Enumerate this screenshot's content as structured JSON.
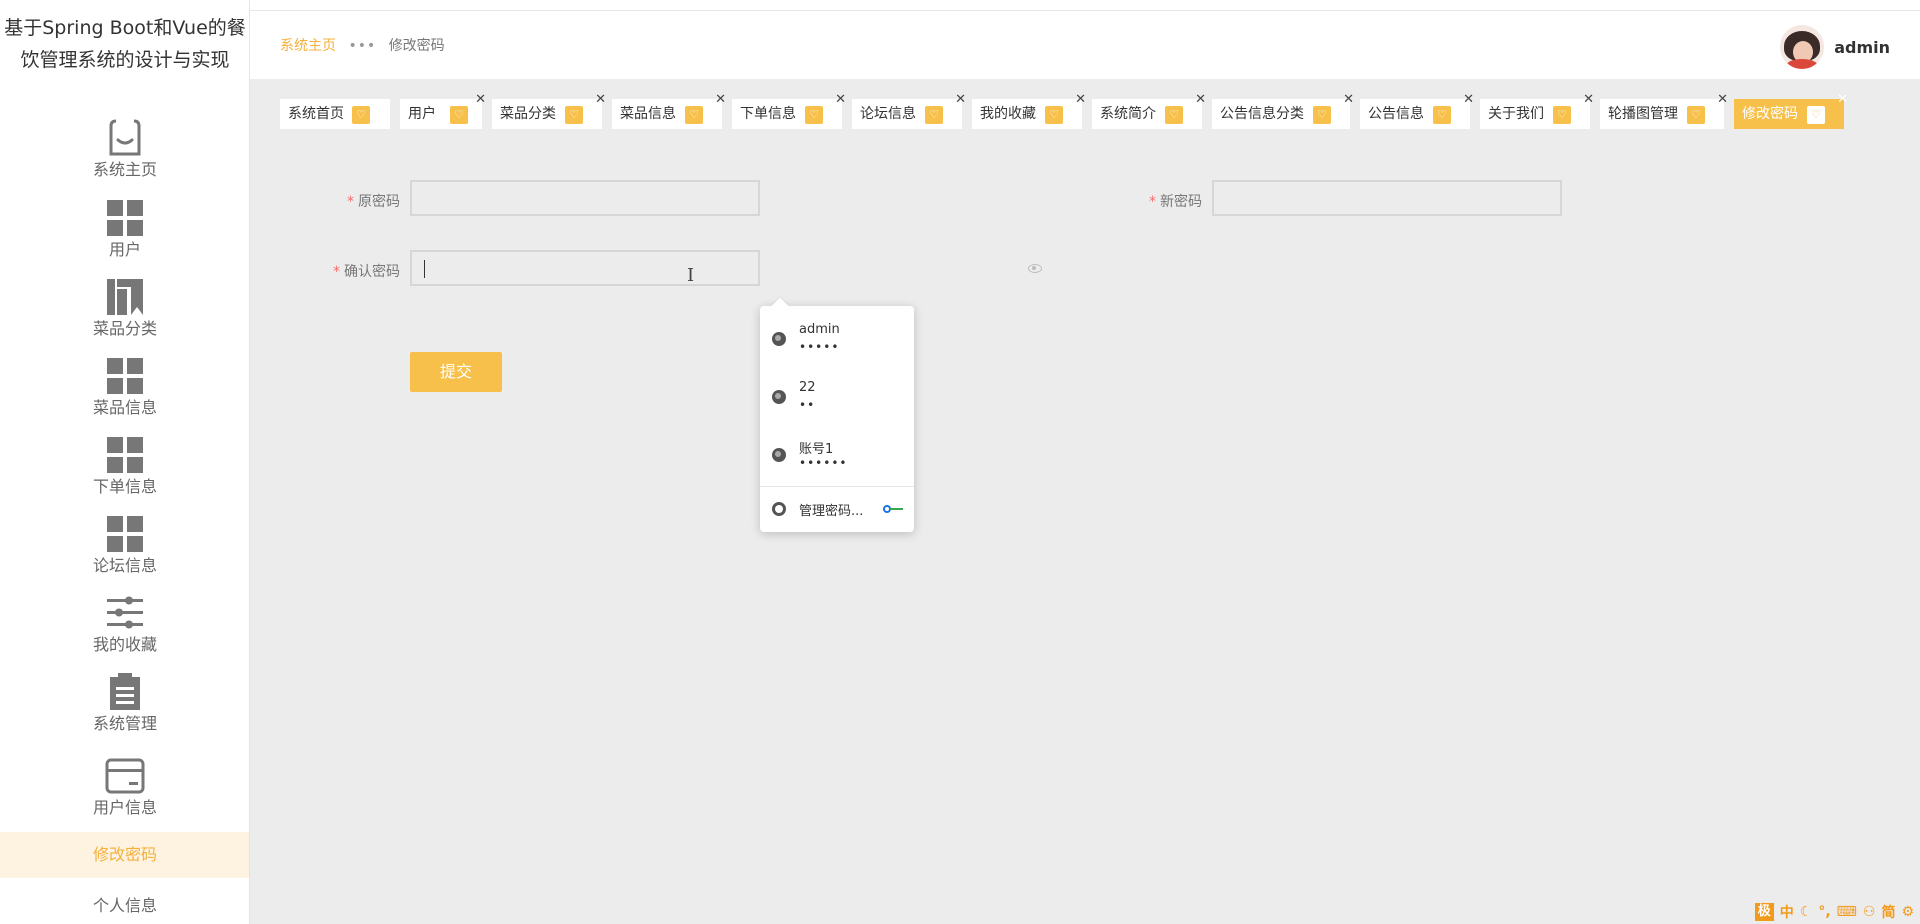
{
  "app": {
    "title": "基于Spring Boot和Vue的餐饮管理系统的设计与实现"
  },
  "sidebar": {
    "items": [
      {
        "label": "系统主页",
        "icon": "bag-smile-icon"
      },
      {
        "label": "用户",
        "icon": "grid-icon"
      },
      {
        "label": "菜品分类",
        "icon": "bookmarks-icon"
      },
      {
        "label": "菜品信息",
        "icon": "grid-icon"
      },
      {
        "label": "下单信息",
        "icon": "grid-icon"
      },
      {
        "label": "论坛信息",
        "icon": "grid-icon"
      },
      {
        "label": "我的收藏",
        "icon": "sliders-icon"
      },
      {
        "label": "系统管理",
        "icon": "clipboard-icon"
      },
      {
        "label": "用户信息",
        "icon": "card-icon"
      }
    ],
    "submenu": [
      {
        "label": "修改密码",
        "active": true
      },
      {
        "label": "个人信息",
        "active": false
      }
    ]
  },
  "header": {
    "breadcrumb": {
      "home": "系统主页",
      "separator": "•••",
      "current": "修改密码"
    },
    "user": {
      "name": "admin"
    }
  },
  "tabs": [
    {
      "label": "系统首页",
      "closable": false,
      "active": false
    },
    {
      "label": "用户",
      "closable": true,
      "active": false
    },
    {
      "label": "菜品分类",
      "closable": true,
      "active": false
    },
    {
      "label": "菜品信息",
      "closable": true,
      "active": false
    },
    {
      "label": "下单信息",
      "closable": true,
      "active": false
    },
    {
      "label": "论坛信息",
      "closable": true,
      "active": false
    },
    {
      "label": "我的收藏",
      "closable": true,
      "active": false
    },
    {
      "label": "系统简介",
      "closable": true,
      "active": false
    },
    {
      "label": "公告信息分类",
      "closable": true,
      "active": false
    },
    {
      "label": "公告信息",
      "closable": true,
      "active": false
    },
    {
      "label": "关于我们",
      "closable": true,
      "active": false
    },
    {
      "label": "轮播图管理",
      "closable": true,
      "active": false
    },
    {
      "label": "修改密码",
      "closable": true,
      "active": true
    }
  ],
  "form": {
    "old_password_label": "原密码",
    "new_password_label": "新密码",
    "confirm_password_label": "确认密码",
    "required_mark": "*",
    "old_password_value": "",
    "new_password_value": "",
    "confirm_password_value": "",
    "submit_label": "提交"
  },
  "autofill": {
    "entries": [
      {
        "username": "admin",
        "password_mask": "•••••"
      },
      {
        "username": "22",
        "password_mask": "••"
      },
      {
        "username": "账号1",
        "password_mask": "••••••"
      }
    ],
    "manage_label": "管理密码..."
  },
  "ime_toolbar": {
    "logo": "极",
    "mode": "中",
    "script": "简"
  },
  "colors": {
    "accent": "#f7c04a",
    "accent_text": "#f5b03e",
    "content_bg": "#ececec",
    "required": "#f56c6c"
  }
}
